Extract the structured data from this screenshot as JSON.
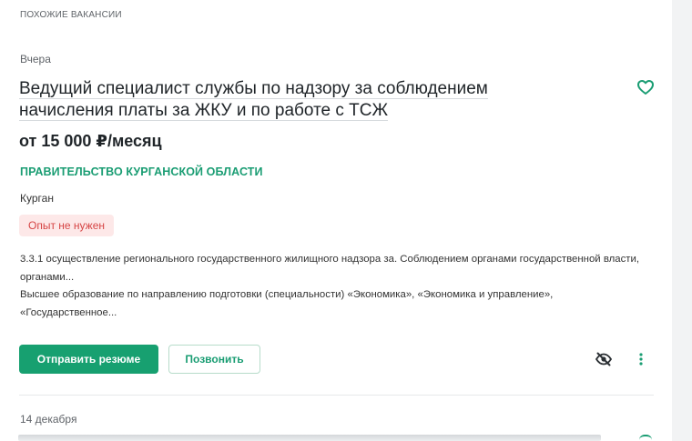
{
  "section": {
    "title": "ПОХОЖИЕ ВАКАНСИИ"
  },
  "vacancy": {
    "date": "Вчера",
    "title_line1": "Ведущий специалист службы по надзору за соблюдением",
    "title_line2": "начисления платы за ЖКУ и по работе с ТСЖ",
    "salary": "от 15 000 ₽/месяц",
    "company": "ПРАВИТЕЛЬСТВО КУРГАНСКОЙ ОБЛАСТИ",
    "city": "Курган",
    "badge": "Опыт не нужен",
    "description_1": "3.3.1 осуществление регионального государственного жилищного надзора за. Соблюдением органами государственной власти, органами...",
    "description_2": "Высшее образование по направлению подготовки (специальности) «Экономика», «Экономика и управление», «Государственное...",
    "apply_label": "Отправить резюме",
    "call_label": "Позвонить",
    "favorite_icon": "heart-outline-icon",
    "hide_icon": "eye-off-icon",
    "more_icon": "more-vertical-icon"
  },
  "next_vacancy": {
    "date": "14 декабря"
  },
  "colors": {
    "accent": "#17a070",
    "company_text": "#1a9d73",
    "badge_bg": "#fde8e8",
    "badge_text": "#d64545"
  }
}
